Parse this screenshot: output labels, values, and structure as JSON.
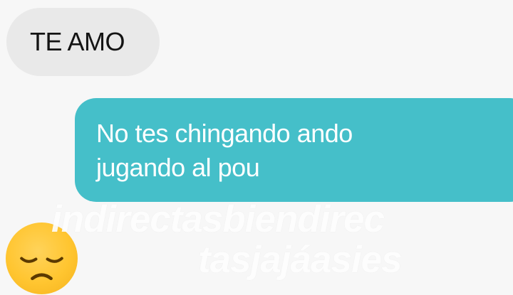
{
  "messages": [
    {
      "direction": "incoming",
      "text": "TE AMO"
    },
    {
      "direction": "outgoing",
      "text": "No tes chingando ando jugando al pou"
    }
  ],
  "overlay": {
    "emoji_icon": "disappointed-face-emoji",
    "watermark": {
      "line1": "indirectasbiendirec",
      "line2": "tasjajáasies"
    }
  },
  "colors": {
    "background": "#f7f7f7",
    "incoming_bubble": "#e9e9e9",
    "outgoing_bubble": "#45bfc9",
    "outgoing_text": "#ffffff",
    "incoming_text": "#141414",
    "emoji": "#ffc530"
  }
}
